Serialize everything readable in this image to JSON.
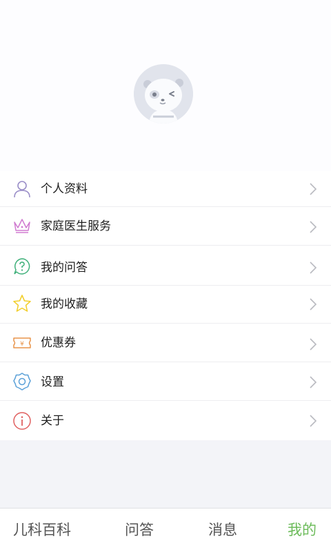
{
  "menu": {
    "items": [
      {
        "label": "个人资料",
        "icon": "person-icon"
      },
      {
        "label": "家庭医生服务",
        "icon": "crown-icon"
      },
      {
        "label": "我的问答",
        "icon": "question-bubble-icon"
      },
      {
        "label": "我的收藏",
        "icon": "star-icon"
      },
      {
        "label": "优惠券",
        "icon": "coupon-icon"
      },
      {
        "label": "设置",
        "icon": "settings-icon"
      },
      {
        "label": "关于",
        "icon": "info-icon"
      }
    ]
  },
  "tabbar": {
    "tabs": [
      {
        "label": "儿科百科"
      },
      {
        "label": "问答"
      },
      {
        "label": "消息"
      },
      {
        "label": "我的",
        "active": true
      }
    ]
  },
  "colors": {
    "accent_green": "#6cbb5a",
    "person": "#9a8ec8",
    "crown": "#d07ad0",
    "question": "#3fb07a",
    "star": "#f2cf2f",
    "coupon": "#e8944a",
    "settings": "#5aa0d8",
    "info": "#e06060"
  }
}
